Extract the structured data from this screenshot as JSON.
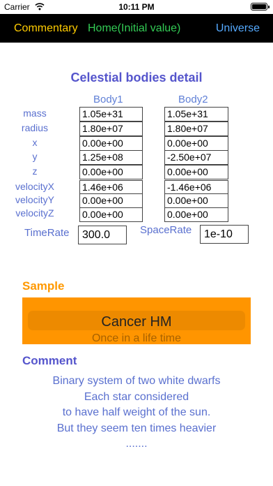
{
  "status": {
    "carrier": "Carrier",
    "time": "10:11 PM"
  },
  "nav": {
    "commentary": "Commentary",
    "home": "Home(Initial value)",
    "universe": "Universe"
  },
  "title": "Celestial bodies detail",
  "columns": [
    "Body1",
    "Body2"
  ],
  "rows": [
    {
      "label": "mass",
      "body1": "1.05e+31",
      "body2": "1.05e+31"
    },
    {
      "label": "radius",
      "body1": "1.80e+07",
      "body2": "1.80e+07"
    },
    {
      "label": "x",
      "body1": "0.00e+00",
      "body2": "0.00e+00"
    },
    {
      "label": "y",
      "body1": "1.25e+08",
      "body2": "-2.50e+07"
    },
    {
      "label": "z",
      "body1": "0.00e+00",
      "body2": "0.00e+00"
    },
    {
      "label": "velocityX",
      "body1": "1.46e+06",
      "body2": "-1.46e+06"
    },
    {
      "label": "velocityY",
      "body1": "0.00e+00",
      "body2": "0.00e+00"
    },
    {
      "label": "velocityZ",
      "body1": "0.00e+00",
      "body2": "0.00e+00"
    }
  ],
  "time_rate": {
    "label": "TimeRate",
    "value": "300.0"
  },
  "space_rate": {
    "label": "SpaceRate",
    "value": "1e-10"
  },
  "sample": {
    "heading": "Sample",
    "selected": "Cancer HM",
    "next": "Once in a life time"
  },
  "comment": {
    "heading": "Comment",
    "lines": [
      "Binary system of two white dwarfs",
      "Each star considered",
      "to have half weight of the sun.",
      "But they seem ten times heavier",
      "......."
    ]
  }
}
